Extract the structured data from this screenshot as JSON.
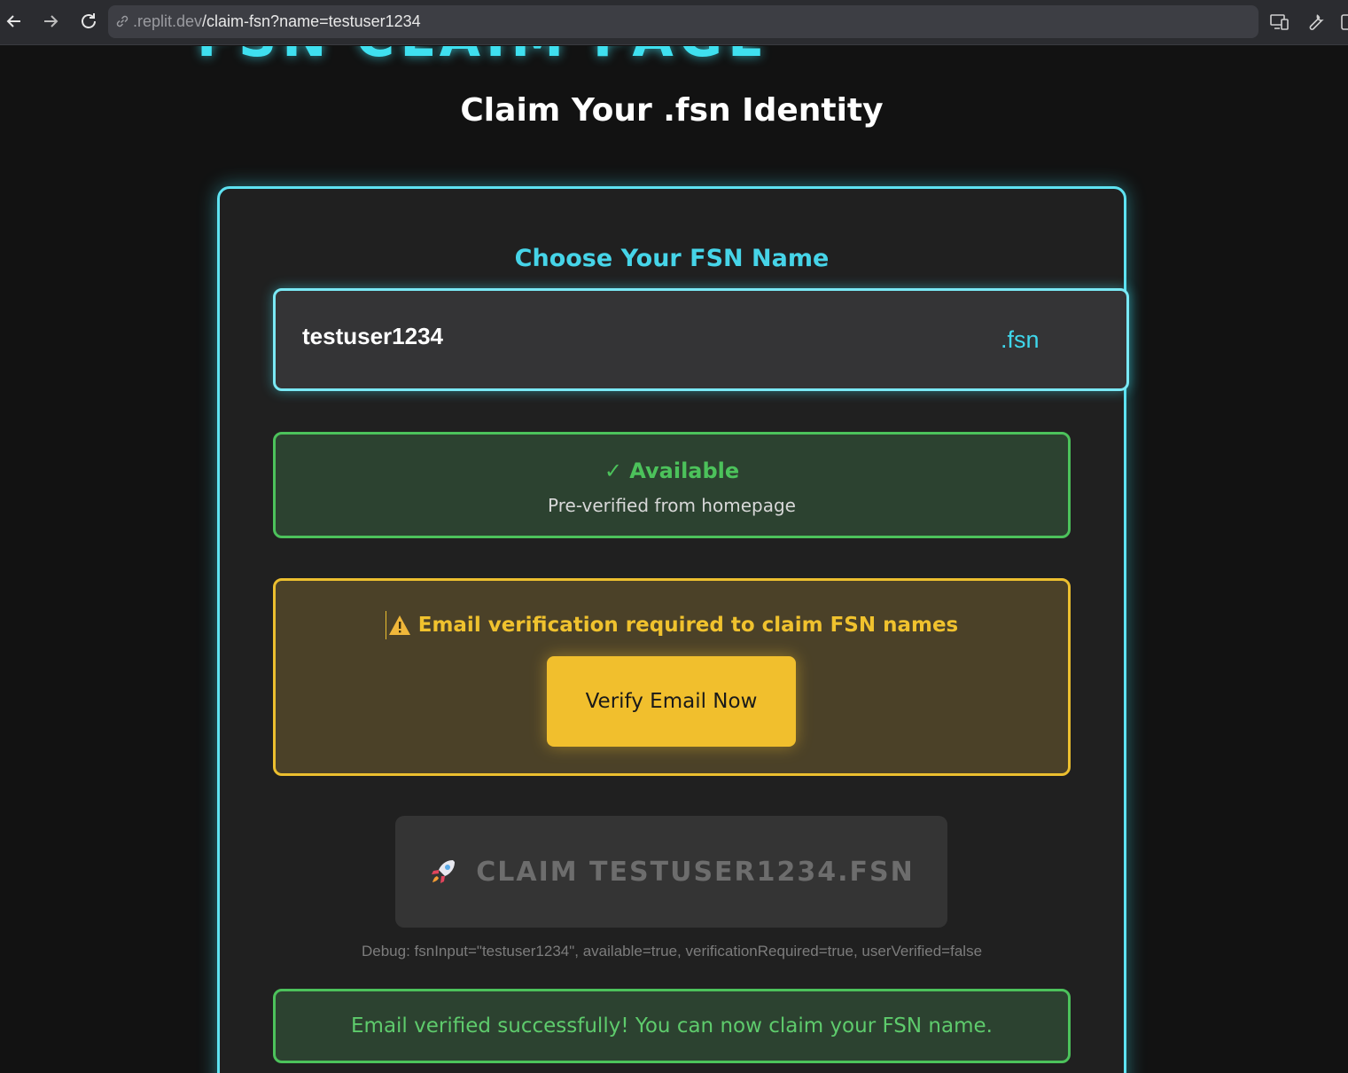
{
  "browser": {
    "url_host": ".replit.dev",
    "url_path": "/claim-fsn?name=testuser1234",
    "icons": [
      "back-arrow-icon",
      "forward-arrow-icon",
      "reload-icon",
      "link-icon",
      "devices-icon",
      "wrench-icon",
      "panel-icon"
    ]
  },
  "page": {
    "title": "Claim Your .fsn Identity"
  },
  "form": {
    "choose_label": "Choose Your FSN Name",
    "input_value": "testuser1234",
    "suffix": ".fsn"
  },
  "availability": {
    "title": "✓ Available",
    "subtitle": "Pre-verified from homepage"
  },
  "verification": {
    "warning_text": "Email verification required to claim FSN names",
    "button_label": "Verify Email Now"
  },
  "claim": {
    "button_label": "CLAIM TESTUSER1234.FSN",
    "icon": "rocket-icon"
  },
  "debug": {
    "text": "Debug: fsnInput=\"testuser1234\", available=true, verificationRequired=true, userVerified=false"
  },
  "success": {
    "text": "Email verified successfully! You can now claim your FSN name."
  },
  "colors": {
    "accent_cyan": "#40e0f0",
    "success_green": "#4cc25b",
    "warning_yellow": "#f1bf2d",
    "background": "#121212",
    "card": "#202020"
  }
}
